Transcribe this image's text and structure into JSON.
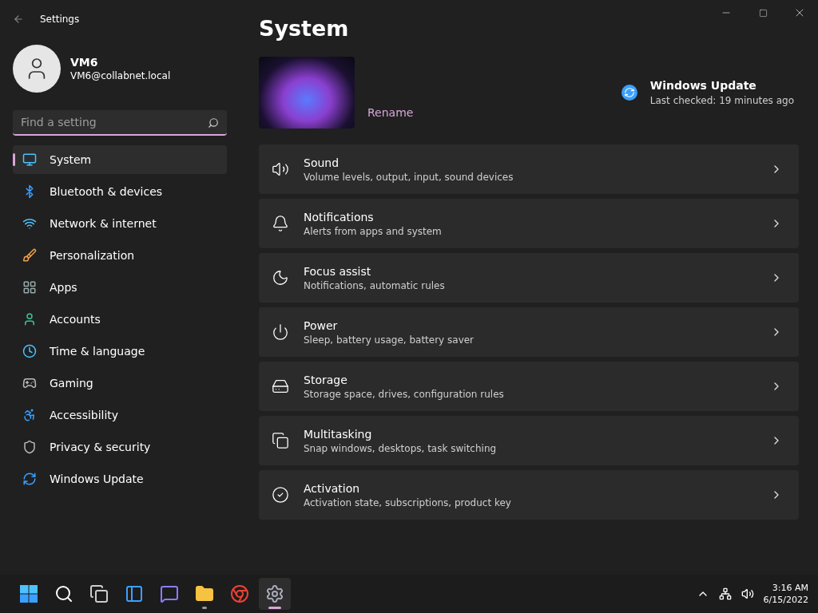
{
  "window": {
    "title": "Settings"
  },
  "profile": {
    "name": "VM6",
    "email": "VM6@collabnet.local"
  },
  "search": {
    "placeholder": "Find a setting"
  },
  "sidebar": {
    "items": [
      {
        "label": "System",
        "kind": "system",
        "selected": true
      },
      {
        "label": "Bluetooth & devices",
        "kind": "bluetooth",
        "selected": false
      },
      {
        "label": "Network & internet",
        "kind": "network",
        "selected": false
      },
      {
        "label": "Personalization",
        "kind": "brush",
        "selected": false
      },
      {
        "label": "Apps",
        "kind": "apps",
        "selected": false
      },
      {
        "label": "Accounts",
        "kind": "accounts",
        "selected": false
      },
      {
        "label": "Time & language",
        "kind": "time",
        "selected": false
      },
      {
        "label": "Gaming",
        "kind": "gaming",
        "selected": false
      },
      {
        "label": "Accessibility",
        "kind": "accessibility",
        "selected": false
      },
      {
        "label": "Privacy & security",
        "kind": "privacy",
        "selected": false
      },
      {
        "label": "Windows Update",
        "kind": "update",
        "selected": false
      }
    ]
  },
  "page": {
    "title": "System",
    "rename": "Rename",
    "update": {
      "title": "Windows Update",
      "status": "Last checked: 19 minutes ago"
    }
  },
  "cards": [
    {
      "title": "Sound",
      "subtitle": "Volume levels, output, input, sound devices",
      "kind": "sound"
    },
    {
      "title": "Notifications",
      "subtitle": "Alerts from apps and system",
      "kind": "bell"
    },
    {
      "title": "Focus assist",
      "subtitle": "Notifications, automatic rules",
      "kind": "moon"
    },
    {
      "title": "Power",
      "subtitle": "Sleep, battery usage, battery saver",
      "kind": "power"
    },
    {
      "title": "Storage",
      "subtitle": "Storage space, drives, configuration rules",
      "kind": "storage"
    },
    {
      "title": "Multitasking",
      "subtitle": "Snap windows, desktops, task switching",
      "kind": "multitask"
    },
    {
      "title": "Activation",
      "subtitle": "Activation state, subscriptions, product key",
      "kind": "check"
    }
  ],
  "taskbar": {
    "apps": [
      {
        "kind": "start",
        "selected": false,
        "running": false
      },
      {
        "kind": "search",
        "selected": false,
        "running": false
      },
      {
        "kind": "taskview",
        "selected": false,
        "running": false
      },
      {
        "kind": "widgets",
        "selected": false,
        "running": false
      },
      {
        "kind": "chat",
        "selected": false,
        "running": false
      },
      {
        "kind": "explorer",
        "selected": false,
        "running": true
      },
      {
        "kind": "browser",
        "selected": false,
        "running": false
      },
      {
        "kind": "settings",
        "selected": true,
        "running": true
      }
    ],
    "time": "3:16 AM",
    "date": "6/15/2022"
  }
}
